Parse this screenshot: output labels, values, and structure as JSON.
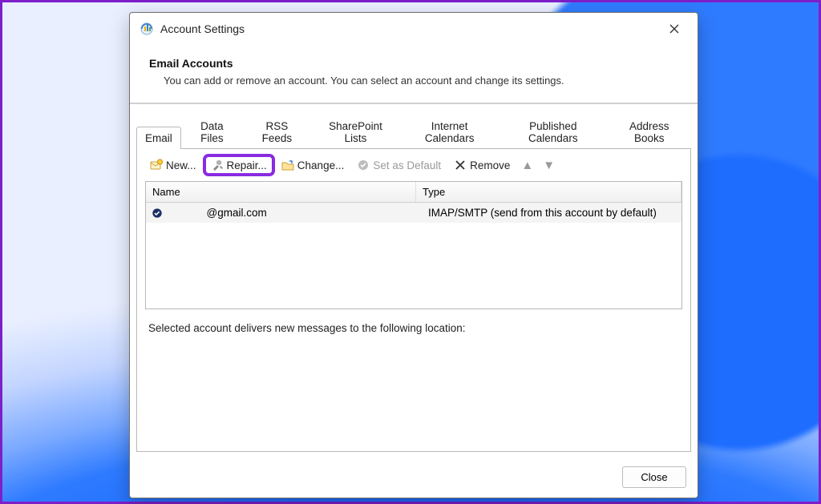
{
  "window": {
    "title": "Account Settings"
  },
  "header": {
    "title": "Email Accounts",
    "subtitle": "You can add or remove an account. You can select an account and change its settings."
  },
  "tabs": [
    {
      "label": "Email",
      "active": true
    },
    {
      "label": "Data Files"
    },
    {
      "label": "RSS Feeds"
    },
    {
      "label": "SharePoint Lists"
    },
    {
      "label": "Internet Calendars"
    },
    {
      "label": "Published Calendars"
    },
    {
      "label": "Address Books"
    }
  ],
  "toolbar": {
    "new": "New...",
    "repair": "Repair...",
    "change": "Change...",
    "set_default": "Set as Default",
    "remove": "Remove"
  },
  "columns": {
    "name": "Name",
    "type": "Type"
  },
  "accounts": [
    {
      "name": "          @gmail.com",
      "type": "IMAP/SMTP (send from this account by default)",
      "default": true
    }
  ],
  "location": {
    "label": "Selected account delivers new messages to the following location:"
  },
  "buttons": {
    "close": "Close"
  }
}
